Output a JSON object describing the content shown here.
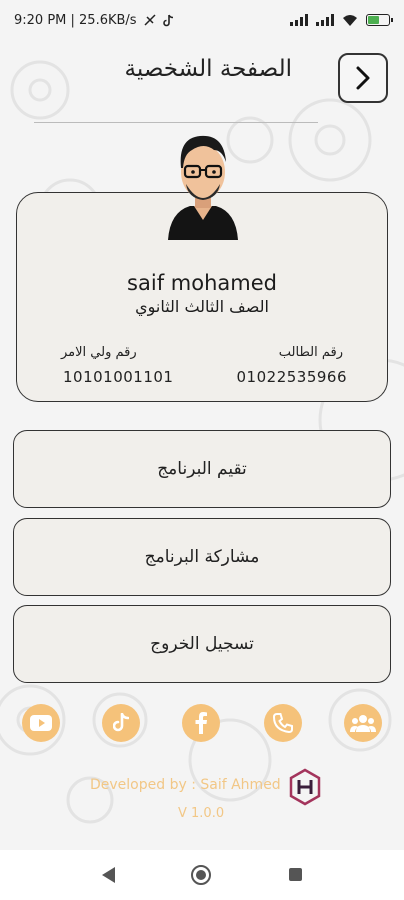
{
  "status_bar": {
    "time_info": "9:20 PM | 25.6KB/s",
    "battery_level": 0.6,
    "battery_color": "#4caf50"
  },
  "header": {
    "title": "الصفحة الشخصية",
    "back_icon": "chevron-right-icon"
  },
  "profile": {
    "name": "saif mohamed",
    "grade": "الصف الثالث الثانوي",
    "guardian_label": "رقم ولي الامر",
    "guardian_number": "10101001101",
    "student_label": "رقم الطالب",
    "student_number": "01022535966"
  },
  "menu": {
    "rate": "تقيم البرنامج",
    "share": "مشاركة البرنامج",
    "logout": "تسجيل الخروج"
  },
  "social": {
    "accent_color": "#f5c27a",
    "icons": [
      "youtube-icon",
      "tiktok-icon",
      "facebook-icon",
      "phone-icon",
      "group-icon"
    ]
  },
  "footer": {
    "developer": "Developed by : Saif Ahmed",
    "version": "V 1.0.0"
  }
}
